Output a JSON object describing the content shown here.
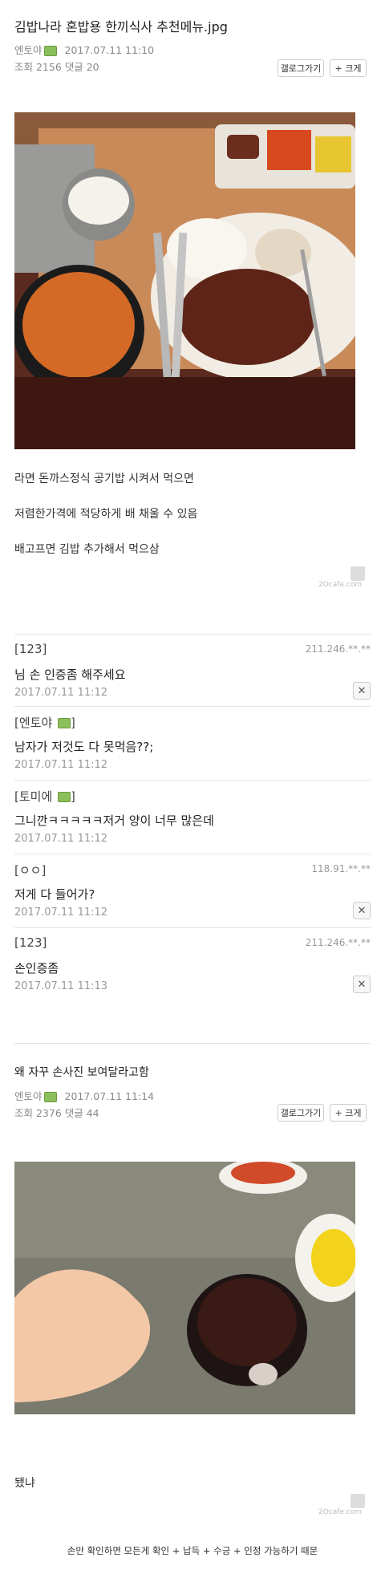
{
  "post1": {
    "title": "김밥나라 혼밥용 한끼식사 추천메뉴.jpg",
    "author": "엔토야",
    "date": "2017.07.11 11:10",
    "stats": "조회 2156 댓글 20",
    "btn_wide": "갤로그가기",
    "btn_big": "+ 크게",
    "lines": [
      "라면 돈까스정식 공기밥 시켜서 먹으면",
      "저렴한가격에 적당하게 배 채울 수 있음",
      "배고프면 김밥 추가해서 먹으삼"
    ],
    "cafe_tag": "2Ocafe.com"
  },
  "comments": [
    {
      "author": "[123]",
      "text": "님 손 인증좀 해주세요",
      "date": "2017.07.11 11:12",
      "ip": "211.246.**.**"
    },
    {
      "author": "[엔토야",
      "text": "남자가 저것도 다 못먹음??;",
      "date": "2017.07.11 11:12",
      "ip": ""
    },
    {
      "author": "[토미에",
      "text": "그니깐ㅋㅋㅋㅋㅋ저거 양이 너무 많은데",
      "date": "2017.07.11 11:12",
      "ip": ""
    },
    {
      "author": "[ㅇㅇ]",
      "text": "저게 다 들어가?",
      "date": "2017.07.11 11:12",
      "ip": "118.91.**.**"
    },
    {
      "author": "[123]",
      "text": "손인증좀",
      "date": "2017.07.11 11:13",
      "ip": "211.246.**.**"
    }
  ],
  "post2": {
    "title": "왜 자꾸 손사진 보여달라고함",
    "author": "엔토야",
    "date": "2017.07.11 11:14",
    "stats": "조회 2376 댓글 44",
    "btn_wide": "갤로그가기",
    "btn_big": "+ 크게",
    "lines": [
      "됐냐"
    ],
    "cafe_tag": "2Ocafe.com"
  },
  "footer": "손만 확인하면 모든게 확인 + 납득 + 수긍 + 인정 가능하기 때문",
  "colors": {
    "badge": "#8bbf5a",
    "text": "#333333",
    "meta": "#888888"
  }
}
